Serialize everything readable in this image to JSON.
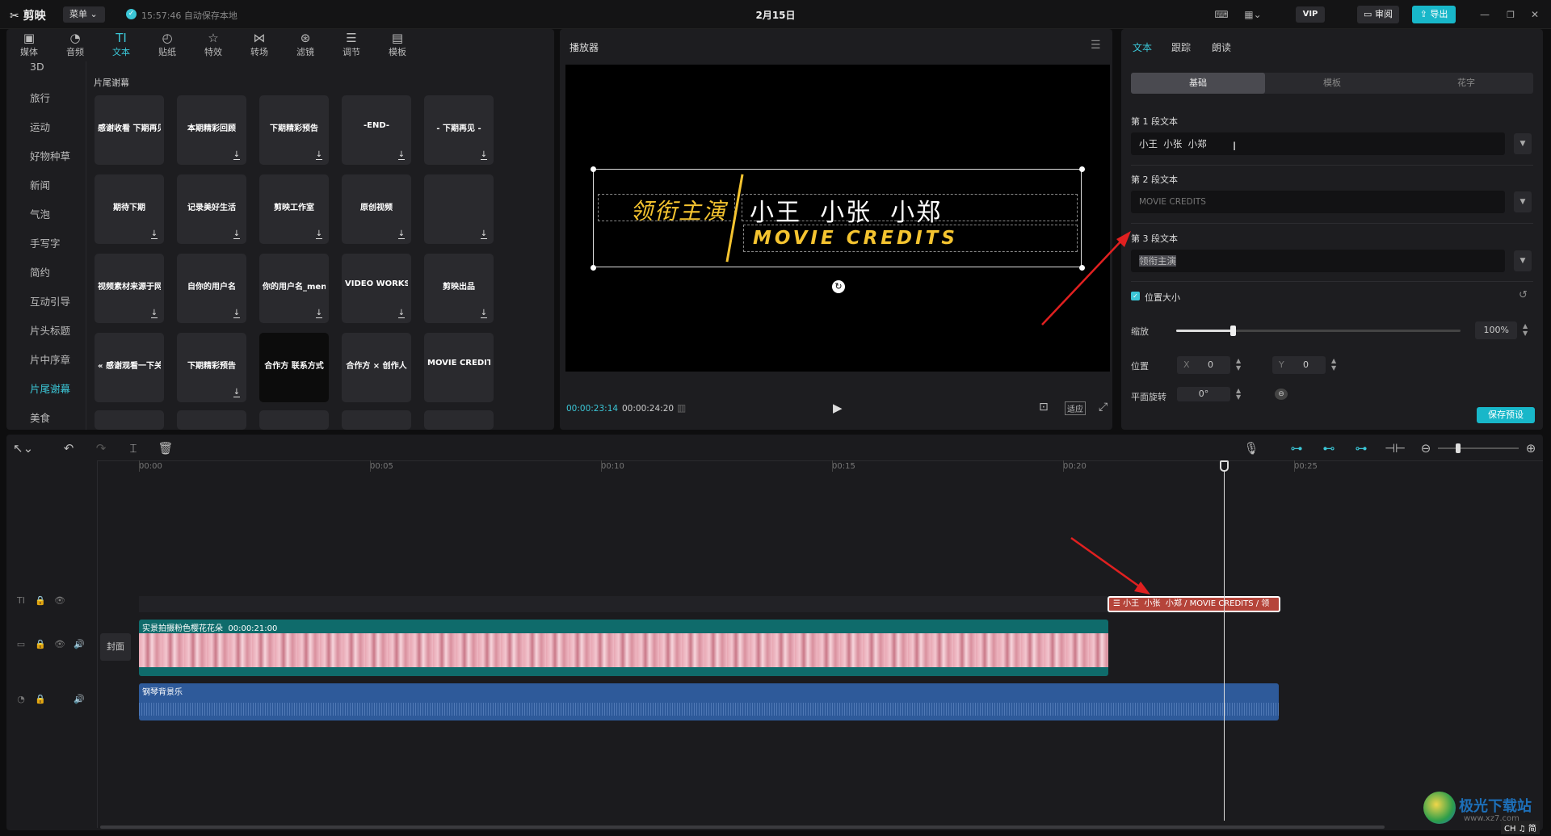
{
  "app": {
    "name": "剪映",
    "menu_label": "菜单",
    "save_status": "15:57:46 自动保存本地",
    "doc_title": "2月15日",
    "vip_label": "VIP",
    "review_label": "审阅",
    "export_label": "导出"
  },
  "categories": [
    {
      "label": "媒体",
      "icon": "▣"
    },
    {
      "label": "音频",
      "icon": "◔"
    },
    {
      "label": "文本",
      "icon": "TI"
    },
    {
      "label": "贴纸",
      "icon": "◴"
    },
    {
      "label": "特效",
      "icon": "☆"
    },
    {
      "label": "转场",
      "icon": "⋈"
    },
    {
      "label": "滤镜",
      "icon": "⊛"
    },
    {
      "label": "调节",
      "icon": "☰"
    },
    {
      "label": "模板",
      "icon": "▤"
    }
  ],
  "sidebar": {
    "items": [
      "3D",
      "旅行",
      "运动",
      "好物种草",
      "新闻",
      "气泡",
      "手写字",
      "简约",
      "互动引导",
      "片头标题",
      "片中序章",
      "片尾谢幕",
      "美食"
    ],
    "active": "片尾谢幕"
  },
  "section_title": "片尾谢幕",
  "tiles": [
    {
      "text": "感谢收看 下期再见 »",
      "bg": "#2a2a2e"
    },
    {
      "text": "本期精彩回顾",
      "bg": "#2a2a2e"
    },
    {
      "text": "下期精彩预告",
      "bg": "#2a2a2e"
    },
    {
      "text": "-END-",
      "bg": "#2a2a2e"
    },
    {
      "text": "- 下期再见 -",
      "bg": "#2a2a2e"
    },
    {
      "text": "期待下期",
      "bg": "#2a2a2e"
    },
    {
      "text": "记录美好生活",
      "bg": "#2a2a2e"
    },
    {
      "text": "剪映工作室",
      "bg": "#2a2a2e"
    },
    {
      "text": "原创视频",
      "bg": "#2a2a2e"
    },
    {
      "text": "",
      "bg": "#2a2a2e"
    },
    {
      "text": "视频素材来源于网络",
      "bg": "#2a2a2e"
    },
    {
      "text": "自你的用户名",
      "bg": "#2a2a2e"
    },
    {
      "text": "你的用户名_meng",
      "bg": "#2a2a2e"
    },
    {
      "text": "VIDEO WORKS BY ME",
      "bg": "#2a2a2e"
    },
    {
      "text": "剪映出品",
      "bg": "#2a2a2e"
    },
    {
      "text": "« 感谢观看一下关注 »",
      "bg": "#2a2a2e"
    },
    {
      "text": "下期精彩预告",
      "bg": "#2a2a2e"
    },
    {
      "text": "合作方 联系方式",
      "bg": "#0c0c0c"
    },
    {
      "text": "合作方 × 创作人",
      "bg": "#2a2a2e"
    },
    {
      "text": "MOVIE CREDITS",
      "bg": "#2a2a2e"
    }
  ],
  "player": {
    "title": "播放器",
    "current_time": "00:00:23:14",
    "total_time": "00:00:24:20",
    "ratio_label": "适应",
    "title_main": "领衔主演",
    "names": "小王  小张  小郑",
    "credits": "MOVIE CREDITS"
  },
  "props": {
    "tabs": [
      "文本",
      "跟踪",
      "朗读"
    ],
    "subtabs": [
      "基础",
      "模板",
      "花字"
    ],
    "para1_label": "第 1 段文本",
    "para1_value": "小王  小张  小郑",
    "para2_label": "第 2 段文本",
    "para2_value": "MOVIE CREDITS",
    "para3_label": "第 3 段文本",
    "para3_value": "领衔主演",
    "pos_size_label": "位置大小",
    "scale_label": "缩放",
    "scale_value": "100%",
    "scale_level": 0.2,
    "position_label": "位置",
    "x_label": "X",
    "x_value": "0",
    "y_label": "Y",
    "y_value": "0",
    "rotate_label": "平面旋转",
    "rotate_value": "0°",
    "save_preset": "保存预设"
  },
  "timeline": {
    "ticks": [
      "00:00",
      "00:05",
      "00:10",
      "00:15",
      "00:20",
      "00:25"
    ],
    "cover_label": "封面",
    "text_clip": "小王  小张  小郑 / MOVIE CREDITS / 领",
    "video_clip_name": "实景拍摄粉色樱花花朵",
    "video_clip_duration": "00:00:21:00",
    "audio_clip_name": "钢琴背景乐"
  },
  "watermark": {
    "site": "极光下载站",
    "url": "www.xz7.com",
    "ime": "CH ♫ 简"
  },
  "colors": {
    "accent": "#3bc6d6",
    "arrow": "#e02020",
    "text_clip": "#b5443a",
    "video_clip": "#0f6b6b",
    "audio_clip": "#2e5a9a",
    "gold": "#f5c430"
  }
}
